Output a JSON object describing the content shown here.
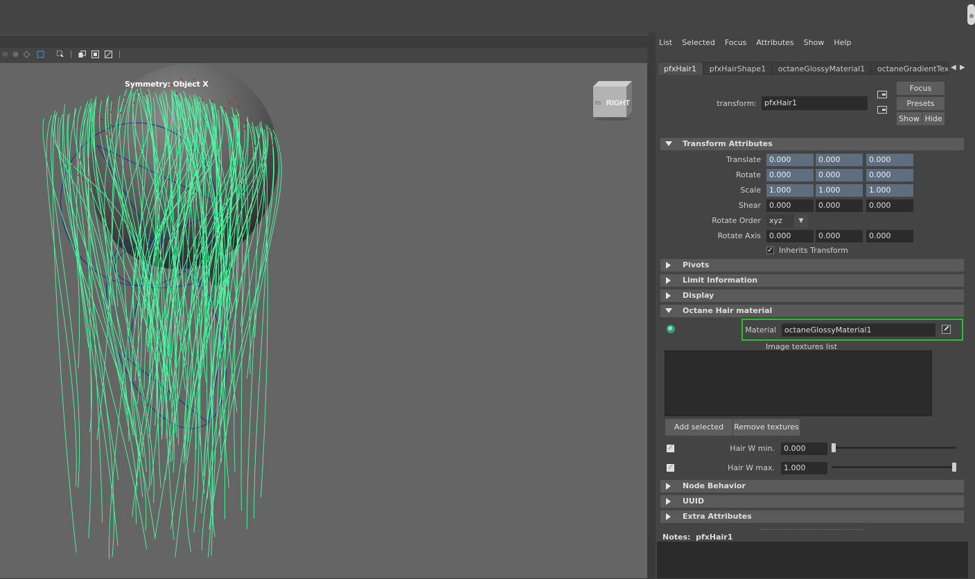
{
  "viewport": {
    "symmetry_label": "Symmetry: Object X",
    "viewcube_label": "RIGHT",
    "hair_color": "#4dfca3",
    "guide_color": "#1e2d8c",
    "dot_color": "#d01818"
  },
  "attribute_editor": {
    "menu": [
      "List",
      "Selected",
      "Focus",
      "Attributes",
      "Show",
      "Help"
    ],
    "tabs": [
      "pfxHair1",
      "pfxHairShape1",
      "octaneGlossyMaterial1",
      "octaneGradientText"
    ],
    "transform_label": "transform:",
    "transform_value": "pfxHair1",
    "focus_button": "Focus",
    "presets_button": "Presets",
    "show_button": "Show",
    "hide_button": "Hide",
    "transform_section": "Transform Attributes",
    "rows": {
      "translate": {
        "label": "Translate",
        "values": [
          "0.000",
          "0.000",
          "0.000"
        ]
      },
      "rotate": {
        "label": "Rotate",
        "values": [
          "0.000",
          "0.000",
          "0.000"
        ]
      },
      "scale": {
        "label": "Scale",
        "values": [
          "1.000",
          "1.000",
          "1.000"
        ]
      },
      "shear": {
        "label": "Shear",
        "values": [
          "0.000",
          "0.000",
          "0.000"
        ]
      },
      "rotate_order": {
        "label": "Rotate Order",
        "value": "xyz"
      },
      "rotate_axis": {
        "label": "Rotate Axis",
        "values": [
          "0.000",
          "0.000",
          "0.000"
        ]
      }
    },
    "inherits_transform": "Inherits Transform",
    "sections": {
      "pivots": "Pivots",
      "limit": "Limit Information",
      "display": "Display",
      "octane": "Octane Hair material",
      "node_behavior": "Node Behavior",
      "uuid": "UUID",
      "extra": "Extra Attributes"
    },
    "material_label": "Material",
    "material_value": "octaneGlossyMaterial1",
    "highlight_color": "#22c42a",
    "image_textures_label": "Image textures list",
    "add_selected": "Add selected",
    "remove_textures": "Remove textures",
    "hair_w_min": {
      "label": "Hair W min.",
      "value": "0.000",
      "fraction": 0
    },
    "hair_w_max": {
      "label": "Hair W max.",
      "value": "1.000",
      "fraction": 1
    },
    "notes_label": "Notes:",
    "notes_value": "pfxHair1"
  }
}
